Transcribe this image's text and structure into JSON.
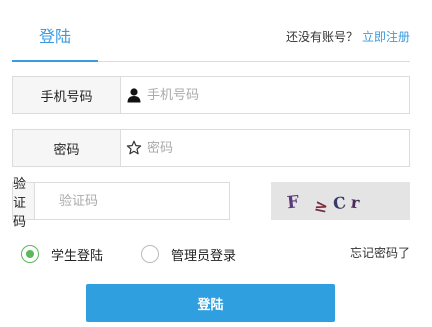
{
  "header": {
    "tab_label": "登陆",
    "no_account_text": "还没有账号？",
    "register_link": "立即注册"
  },
  "form": {
    "phone": {
      "label": "手机号码",
      "placeholder": "手机号码",
      "icon": "user-icon"
    },
    "password": {
      "label": "密码",
      "placeholder": "密码",
      "icon": "star-icon"
    },
    "captcha": {
      "label": "验证码",
      "placeholder": "验证码",
      "image_text": "F ≥ Cr"
    }
  },
  "roles": {
    "student_label": "学生登陆",
    "admin_label": "管理员登录",
    "selected": "student"
  },
  "forgot_link": "忘记密码了",
  "submit_label": "登陆",
  "colors": {
    "accent": "#3b9be0",
    "button": "#2f9fdf",
    "radio_checked": "#5cb85c"
  }
}
